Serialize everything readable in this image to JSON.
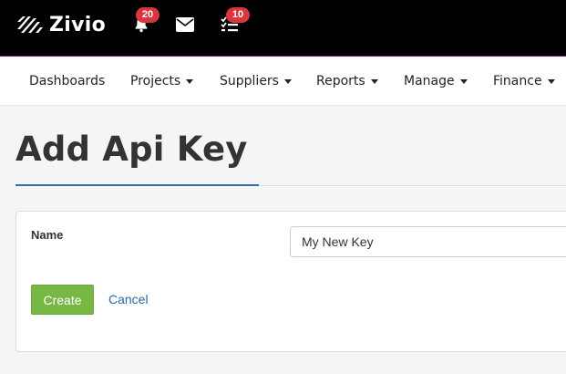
{
  "brand": {
    "name": "Zivio"
  },
  "topbar": {
    "notifications": {
      "icon": "bell-icon",
      "count": "20"
    },
    "messages": {
      "icon": "envelope-icon"
    },
    "tasks": {
      "icon": "tasklist-icon",
      "count": "10"
    }
  },
  "nav": {
    "items": [
      {
        "label": "Dashboards",
        "dropdown": false
      },
      {
        "label": "Projects",
        "dropdown": true
      },
      {
        "label": "Suppliers",
        "dropdown": true
      },
      {
        "label": "Reports",
        "dropdown": true
      },
      {
        "label": "Manage",
        "dropdown": true
      },
      {
        "label": "Finance",
        "dropdown": true
      }
    ]
  },
  "page": {
    "title": "Add Api Key"
  },
  "form": {
    "name_label": "Name",
    "name_value": "My New Key",
    "create_label": "Create",
    "cancel_label": "Cancel"
  },
  "colors": {
    "topbar_bg": "#000000",
    "badge": "#d9363e",
    "accent_rule": "#3b6aa6",
    "create_button": "#79b744",
    "link": "#2f6aa6"
  }
}
